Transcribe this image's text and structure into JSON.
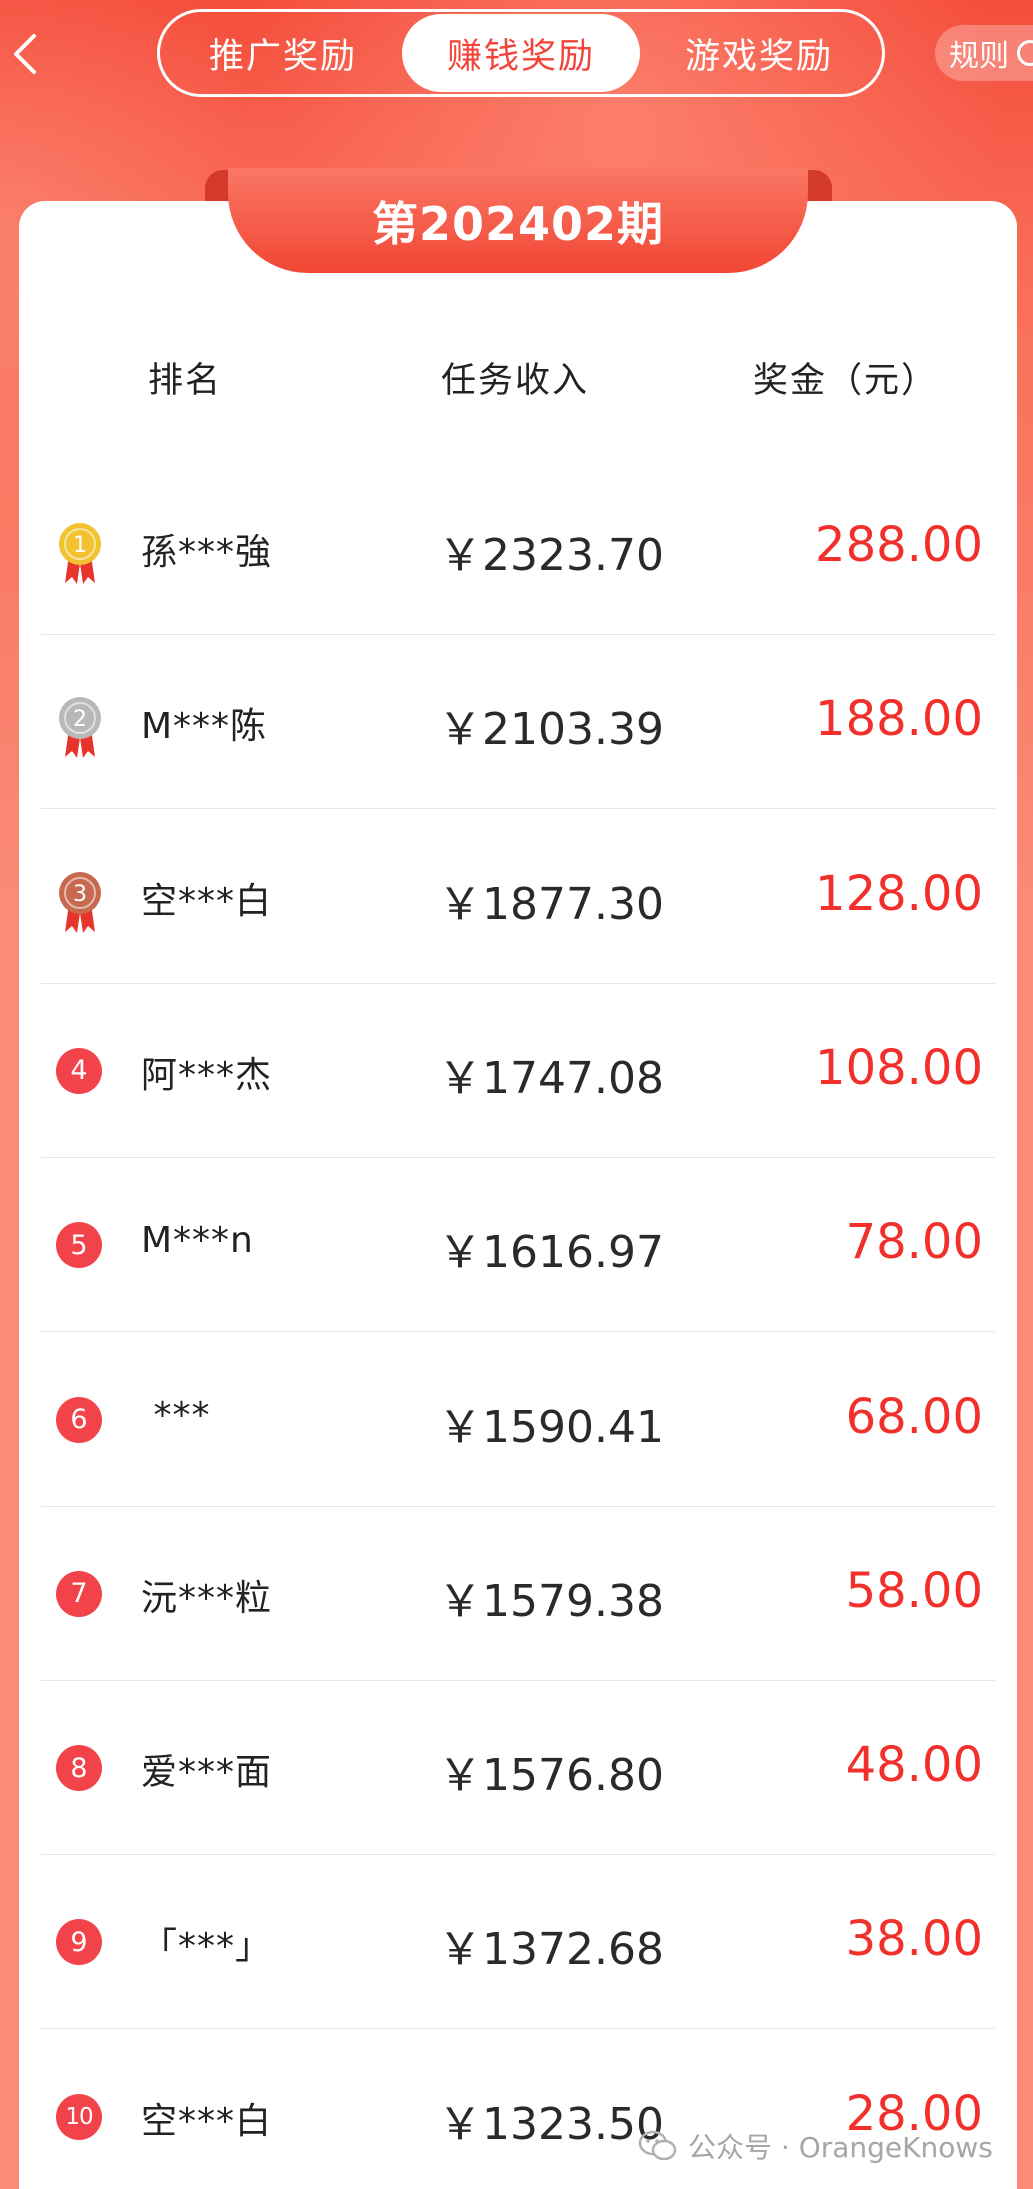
{
  "header": {
    "tabs": [
      {
        "label": "推广奖励",
        "active": false
      },
      {
        "label": "赚钱奖励",
        "active": true
      },
      {
        "label": "游戏奖励",
        "active": false
      }
    ],
    "rules_label": "规则"
  },
  "period": "第202402期",
  "columns": {
    "rank": "排名",
    "income": "任务收入",
    "prize": "奖金（元）"
  },
  "rows": [
    {
      "rank": "1",
      "name": "孫***強",
      "income": "￥2323.70",
      "prize": "288.00"
    },
    {
      "rank": "2",
      "name": "M***陈",
      "income": "￥2103.39",
      "prize": "188.00"
    },
    {
      "rank": "3",
      "name": "空***白",
      "income": "￥1877.30",
      "prize": "128.00"
    },
    {
      "rank": "4",
      "name": "阿***杰",
      "income": "￥1747.08",
      "prize": "108.00"
    },
    {
      "rank": "5",
      "name": "M***n",
      "income": "￥1616.97",
      "prize": "78.00"
    },
    {
      "rank": "6",
      "name": " ***",
      "income": "￥1590.41",
      "prize": "68.00"
    },
    {
      "rank": "7",
      "name": "沅***粒",
      "income": "￥1579.38",
      "prize": "58.00"
    },
    {
      "rank": "8",
      "name": "爱***面",
      "income": "￥1576.80",
      "prize": "48.00"
    },
    {
      "rank": "9",
      "name": "「***」",
      "income": "￥1372.68",
      "prize": "38.00"
    },
    {
      "rank": "10",
      "name": "空***白",
      "income": "￥1323.50",
      "prize": "28.00"
    }
  ],
  "medals": {
    "gold": "#f2c230",
    "silver": "#b8b8b8",
    "bronze": "#c6694f",
    "ribbon": "#e8342b"
  },
  "colors": {
    "accent": "#f2302b",
    "badge": "#f2434a"
  },
  "watermark": "公众号 · OrangeKnows"
}
